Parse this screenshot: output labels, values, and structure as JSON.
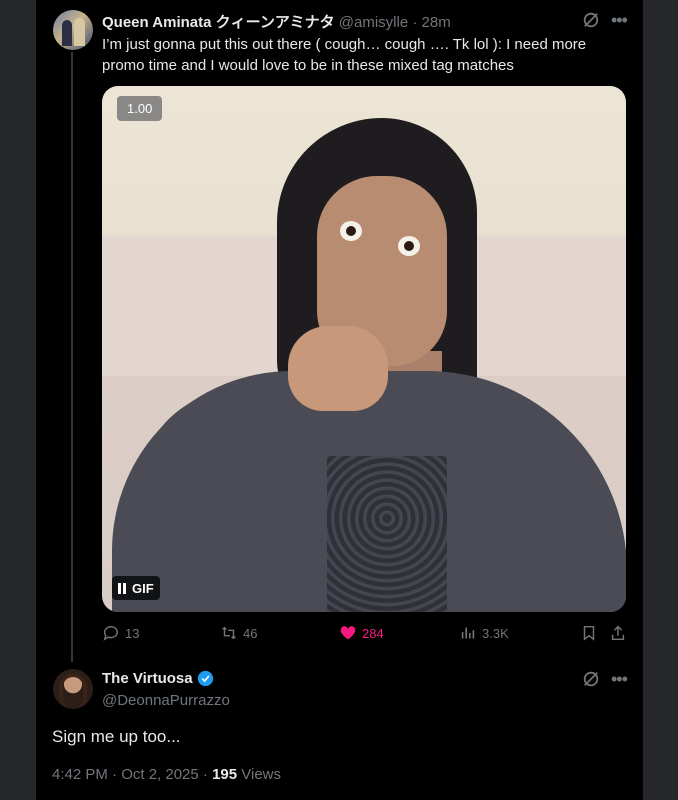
{
  "tweet": {
    "author_name": "Queen Aminata クィーンアミナタ",
    "handle": "@amisylle",
    "separator": "·",
    "time": "28m",
    "text": "I’m just gonna put this out there ( cough… cough …. Tk lol ): I need more promo time and I would love to be in these mixed tag matches",
    "more_icon": "•••",
    "media": {
      "playback_rate": "1.00",
      "gif_label": "GIF"
    },
    "actions": {
      "replies": "13",
      "reposts": "46",
      "likes": "284",
      "views": "3.3K"
    },
    "like_color": "#f91880"
  },
  "reply": {
    "author_name": "The Virtuosa",
    "handle": "@DeonnaPurrazzo",
    "text": "Sign me up too...",
    "timestamp": "4:42 PM · Oct 2, 2025 · ",
    "view_count": "195",
    "views_label": " Views",
    "more_icon": "•••",
    "verified_color": "#1d9bf0"
  }
}
